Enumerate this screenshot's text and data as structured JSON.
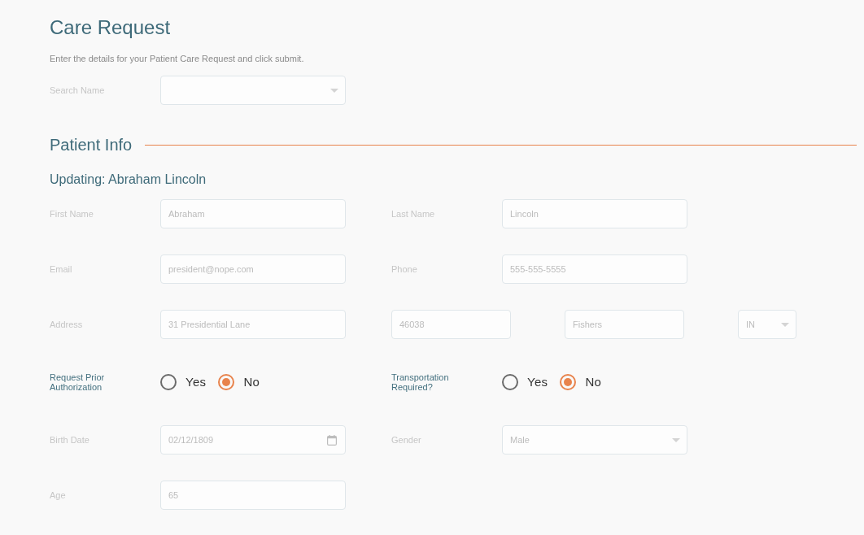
{
  "title": "Care Request",
  "intro": "Enter the details for your Patient Care Request and click submit.",
  "search": {
    "label": "Search Name",
    "kind": "select"
  },
  "patient_info": {
    "heading": "Patient Info",
    "subheading": "Updating: Abraham Lincoln",
    "rows": [
      [
        {
          "label": "First Name",
          "kind": "text",
          "value": "Abraham"
        },
        {
          "label": "Last Name",
          "kind": "text",
          "value": "Lincoln"
        }
      ],
      [
        {
          "label": "Email",
          "kind": "text",
          "value": "president@nope.com"
        },
        {
          "label": "Phone",
          "kind": "text",
          "value": "555-555-5555"
        }
      ],
      [
        {
          "label": "Address",
          "kind": "text",
          "value": "31 Presidential Lane"
        },
        {
          "kind": "group",
          "parts": [
            {
              "kind": "text",
              "value": "46038"
            },
            {
              "kind": "text",
              "value": "Fishers"
            },
            {
              "kind": "select",
              "value": "IN"
            }
          ]
        }
      ],
      [
        {
          "label": "Request Prior Authorization",
          "kind": "radio",
          "options": [
            {
              "label": "Yes",
              "selected": false
            },
            {
              "label": "No",
              "selected": true
            }
          ]
        },
        {
          "label": "Transportation Required?",
          "kind": "radio",
          "options": [
            {
              "label": "Yes",
              "selected": false
            },
            {
              "label": "No",
              "selected": true
            }
          ]
        }
      ],
      [
        {
          "label": "Birth Date",
          "kind": "date",
          "value": "02/12/1809"
        },
        {
          "label": "Gender",
          "kind": "select",
          "value": "Male"
        }
      ],
      [
        {
          "label": "Age",
          "kind": "text",
          "value": "65"
        }
      ]
    ]
  }
}
